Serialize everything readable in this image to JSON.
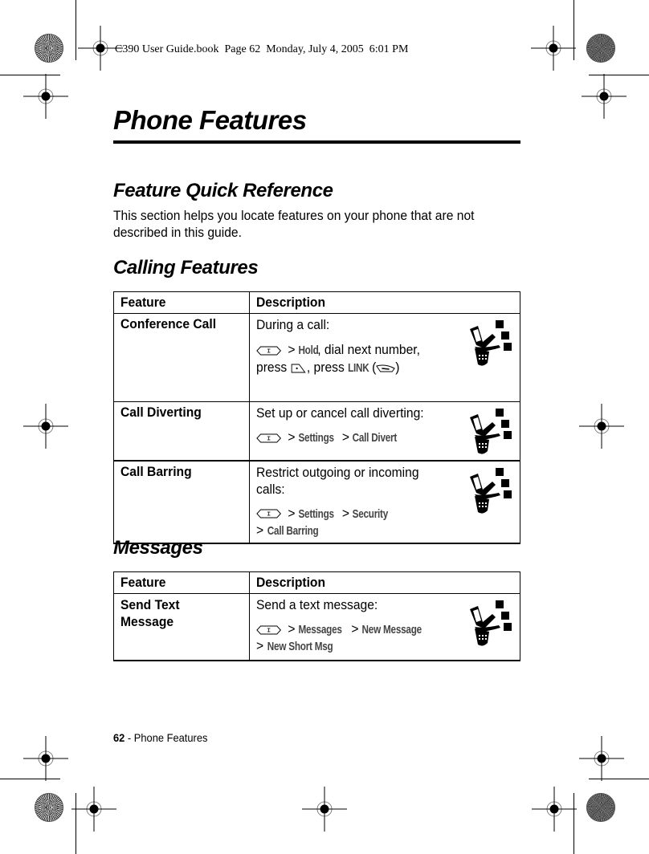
{
  "slug": "C390 User Guide.book  Page 62  Monday, July 4, 2005  6:01 PM",
  "page_title": "Phone Features",
  "section": {
    "title": "Feature Quick Reference",
    "intro": "This section helps you locate features on your phone that are not described in this guide."
  },
  "calling": {
    "title": "Calling Features",
    "headers": {
      "feature": "Feature",
      "description": "Description"
    },
    "rows": [
      {
        "feature": "Conference Call",
        "lead": "During a call:",
        "path_hold": "Hold",
        "after_hold": ", dial next number,",
        "press1": "press",
        "press2": ", press",
        "link": "LINK",
        "open_paren": "(",
        "close_paren": ")",
        "icon": "network-feature-icon"
      },
      {
        "feature": "Call Diverting",
        "lead": "Set up or cancel call diverting:",
        "path": [
          "Settings",
          "Call Divert"
        ],
        "icon": "network-feature-icon"
      },
      {
        "feature": "Call Barring",
        "lead": "Restrict outgoing or incoming calls:",
        "path": [
          "Settings",
          "Security",
          "Call Barring"
        ],
        "icon": "network-feature-icon"
      }
    ]
  },
  "messages": {
    "title": "Messages",
    "headers": {
      "feature": "Feature",
      "description": "Description"
    },
    "rows": [
      {
        "feature": "Send Text Message",
        "lead": "Send a text message:",
        "path": [
          "Messages",
          "New Message",
          "New Short Msg"
        ],
        "icon": "network-feature-icon"
      }
    ]
  },
  "separator": ">",
  "footer": {
    "page_number": "62",
    "dash": " - ",
    "section": "Phone Features"
  },
  "icons": {
    "menu_key": "menu-key-icon",
    "send_key": "send-key-icon",
    "link_key": "right-soft-key-icon"
  }
}
